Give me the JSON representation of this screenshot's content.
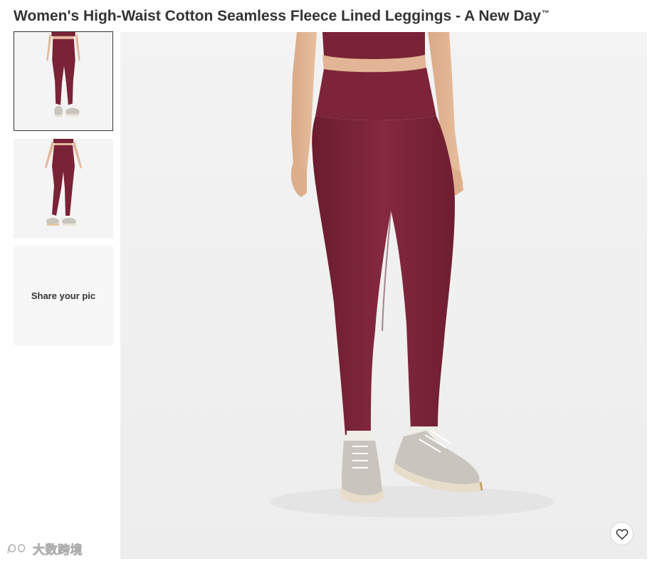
{
  "product": {
    "title": "Women's High-Waist Cotton Seamless Fleece Lined Leggings - A New Day",
    "trademark": "™"
  },
  "gallery": {
    "thumbnails": [
      {
        "view": "front",
        "selected": true
      },
      {
        "view": "back",
        "selected": false
      }
    ],
    "share_label": "Share your pic",
    "hero_view": "front"
  },
  "actions": {
    "favorite_icon": "heart-outline-icon"
  },
  "watermark": {
    "text": "大数跨境"
  },
  "colors": {
    "leggings": "#7a2236",
    "background_tile": "#f7f7f7",
    "hero_background": "#f2f2f2",
    "title_text": "#333333"
  }
}
